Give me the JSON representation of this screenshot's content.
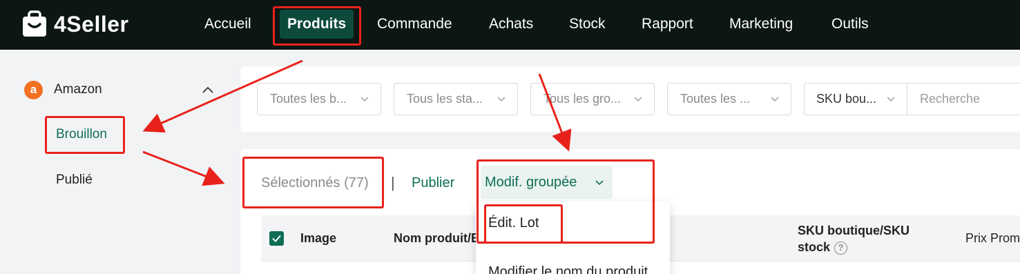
{
  "app": {
    "logo_text": "4Seller",
    "nav": [
      {
        "label": "Accueil",
        "active": false
      },
      {
        "label": "Produits",
        "active": true
      },
      {
        "label": "Commande",
        "active": false
      },
      {
        "label": "Achats",
        "active": false
      },
      {
        "label": "Stock",
        "active": false
      },
      {
        "label": "Rapport",
        "active": false
      },
      {
        "label": "Marketing",
        "active": false
      },
      {
        "label": "Outils",
        "active": false
      }
    ]
  },
  "sidebar": {
    "platform_label": "Amazon",
    "platform_icon_glyph": "a",
    "platform_icon": "amazon-icon",
    "items": [
      {
        "label": "Brouillon",
        "active": true
      },
      {
        "label": "Publié",
        "active": false
      }
    ]
  },
  "filters": {
    "selects": [
      "Toutes les b...",
      "Tous les sta...",
      "Tous les gro...",
      "Toutes les ..."
    ],
    "sku_select": "SKU bou...",
    "search_placeholder": "Recherche"
  },
  "toolbar": {
    "selected_text": "Sélectionnés (77)",
    "separator": "|",
    "publish_label": "Publier",
    "bulk_edit_label": "Modif. groupée"
  },
  "table": {
    "headers": {
      "image": "Image",
      "product_name": "Nom produit/E",
      "sku_line1": "SKU boutique/SKU",
      "sku_line2": "stock",
      "promo_price": "Prix Prom"
    },
    "select_all_checked": true
  },
  "dropdown": {
    "items": [
      "Édit. Lot",
      "Modifier le nom du produit"
    ]
  },
  "colors": {
    "brand_green": "#0e6e55",
    "topbar_bg": "#0c1613",
    "nav_active_bg": "#0e4a3b",
    "annotation_red": "#e8221b",
    "amazon_orange": "#f36f21"
  }
}
